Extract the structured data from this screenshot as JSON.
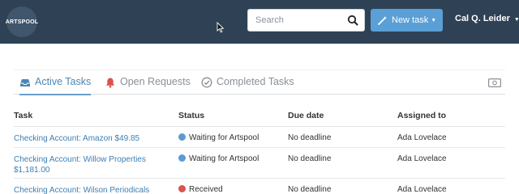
{
  "brand": {
    "logo_text": "ARTSPOOL"
  },
  "header": {
    "search_placeholder": "Search",
    "new_task_label": "New task",
    "user_name": "Cal Q. Leider"
  },
  "tabs": [
    {
      "label": "Active Tasks",
      "icon": "inbox-icon",
      "active": true
    },
    {
      "label": "Open Requests",
      "icon": "bell-icon",
      "active": false
    },
    {
      "label": "Completed Tasks",
      "icon": "check-circle-icon",
      "active": false
    }
  ],
  "table": {
    "headers": [
      "Task",
      "Status",
      "Due date",
      "Assigned to"
    ],
    "rows": [
      {
        "task": "Checking Account: Amazon $49.85",
        "status": "Waiting for Artspool",
        "status_color": "#5b9bd5",
        "due": "No deadline",
        "assigned": "Ada Lovelace"
      },
      {
        "task": "Checking Account: Willow Properties $1,181.00",
        "status": "Waiting for Artspool",
        "status_color": "#5b9bd5",
        "due": "No deadline",
        "assigned": "Ada Lovelace"
      },
      {
        "task": "Checking Account: Wilson Periodicals",
        "status": "Received",
        "status_color": "#d9534f",
        "due": "No deadline",
        "assigned": "Ada Lovelace"
      }
    ]
  },
  "colors": {
    "topbar": "#2f4255",
    "accent": "#5a9fd6",
    "link": "#3d7fb5"
  }
}
